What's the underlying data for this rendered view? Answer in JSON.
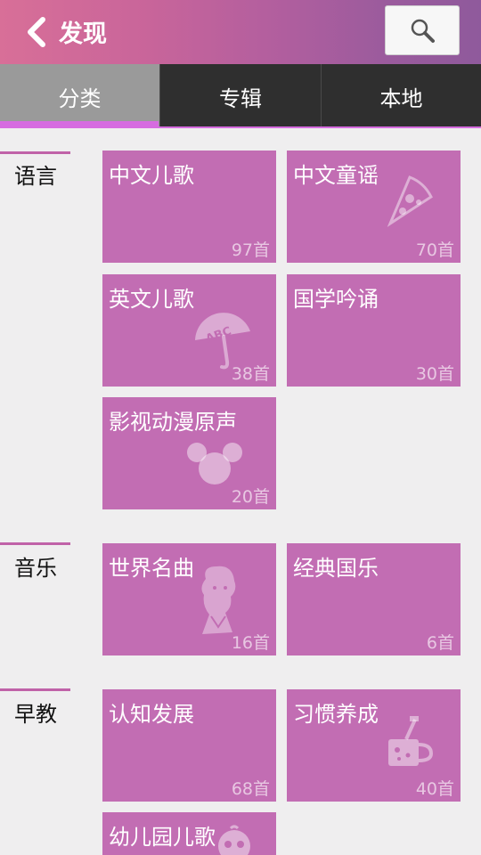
{
  "header": {
    "title": "发现"
  },
  "tabs": [
    {
      "label": "分类"
    },
    {
      "label": "专辑"
    },
    {
      "label": "本地"
    }
  ],
  "sections": [
    {
      "label": "语言",
      "tiles": [
        {
          "name": "中文儿歌",
          "count": "97首"
        },
        {
          "name": "中文童谣",
          "count": "70首",
          "icon": "pizza-icon"
        },
        {
          "name": "英文儿歌",
          "count": "38首",
          "icon": "abc-umbrella-icon"
        },
        {
          "name": "国学吟诵",
          "count": "30首"
        },
        {
          "name": "影视动漫原声",
          "count": "20首",
          "icon": "mouse-ears-icon"
        }
      ]
    },
    {
      "label": "音乐",
      "tiles": [
        {
          "name": "世界名曲",
          "count": "16首",
          "icon": "composer-portrait-icon"
        },
        {
          "name": "经典国乐",
          "count": "6首"
        }
      ]
    },
    {
      "label": "早教",
      "tiles": [
        {
          "name": "认知发展",
          "count": "68首"
        },
        {
          "name": "习惯养成",
          "count": "40首",
          "icon": "toothbrush-cup-icon"
        },
        {
          "name": "幼儿园儿歌",
          "count": "",
          "icon": "baby-face-icon"
        }
      ]
    }
  ],
  "colors": {
    "tile": "#c26db3",
    "accent": "#d66ce0",
    "tab_bar": "#2f2f2f"
  }
}
